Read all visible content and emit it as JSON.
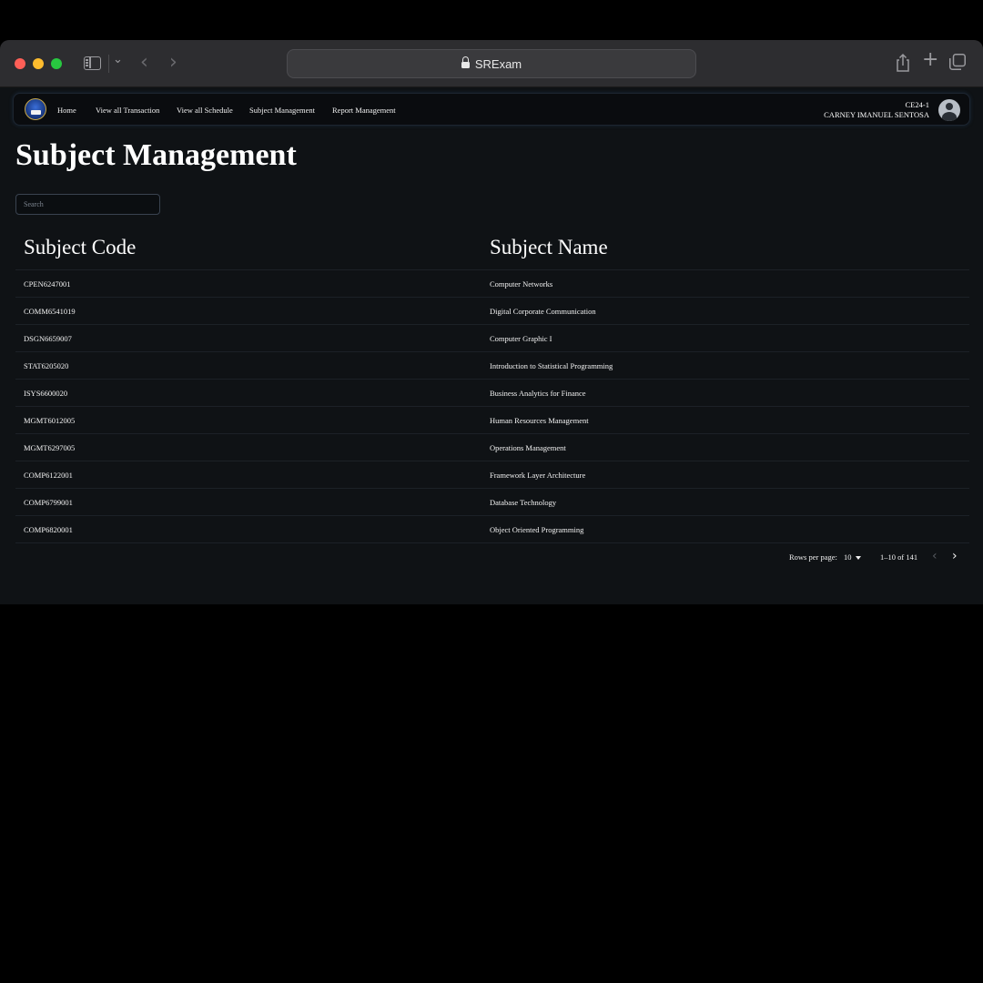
{
  "browser": {
    "url_title": "SRExam"
  },
  "nav": {
    "links": [
      "Home",
      "View all Transaction",
      "View all Schedule",
      "Subject Management",
      "Report Management"
    ],
    "user_code": "CE24-1",
    "user_name": "CARNEY IMANUEL SENTOSA"
  },
  "page": {
    "title": "Subject Management",
    "search_placeholder": "Search"
  },
  "table": {
    "headers": [
      "Subject Code",
      "Subject Name"
    ],
    "rows": [
      [
        "CPEN6247001",
        "Computer Networks"
      ],
      [
        "COMM6541019",
        "Digital Corporate Communication"
      ],
      [
        "DSGN6659007",
        "Computer Graphic I"
      ],
      [
        "STAT6205020",
        "Introduction to Statistical Programming"
      ],
      [
        "ISYS6600020",
        "Business Analytics for Finance"
      ],
      [
        "MGMT6012005",
        "Human Resources Management"
      ],
      [
        "MGMT6297005",
        "Operations Management"
      ],
      [
        "COMP6122001",
        "Framework Layer Architecture"
      ],
      [
        "COMP6799001",
        "Database Technology"
      ],
      [
        "COMP6820001",
        "Object Oriented Programming"
      ]
    ]
  },
  "pagination": {
    "rows_per_page_label": "Rows per page:",
    "rows_per_page_value": "10",
    "range": "1–10 of 141"
  }
}
